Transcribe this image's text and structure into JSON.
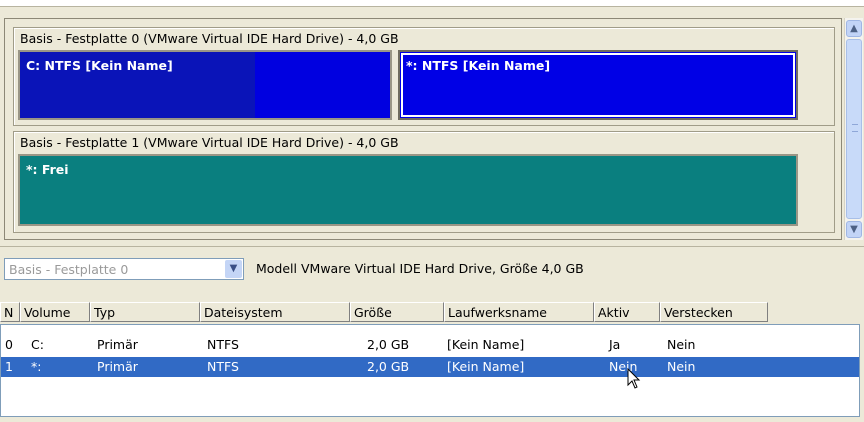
{
  "disks": [
    {
      "title": "Basis - Festplatte 0 (VMware Virtual IDE Hard Drive) - 4,0 GB",
      "partitions": [
        {
          "label": "C: NTFS [Kein Name]"
        },
        {
          "label": "*: NTFS [Kein Name]"
        }
      ]
    },
    {
      "title": "Basis - Festplatte 1 (VMware Virtual IDE Hard Drive) - 4,0 GB",
      "partitions": [
        {
          "label": "*: Frei"
        }
      ]
    }
  ],
  "disk_select": {
    "value": "Basis - Festplatte 0"
  },
  "model_text": "Modell VMware Virtual IDE Hard Drive, Größe 4,0 GB",
  "table": {
    "columns": [
      "N",
      "Volume",
      "Typ",
      "Dateisystem",
      "Größe",
      "Laufwerksname",
      "Aktiv",
      "Verstecken"
    ],
    "rows": [
      [
        "0",
        "C:",
        "Primär",
        "NTFS",
        "2,0 GB",
        "[Kein Name]",
        "Ja",
        "Nein"
      ],
      [
        "1",
        "*:",
        "Primär",
        "NTFS",
        "2,0 GB",
        "[Kein Name]",
        "Nein",
        "Nein"
      ]
    ],
    "selected_row": 1
  },
  "colors": {
    "partition_ntfs": "#0000e0",
    "partition_free": "#0a7f7f",
    "selection": "#316ac5"
  }
}
